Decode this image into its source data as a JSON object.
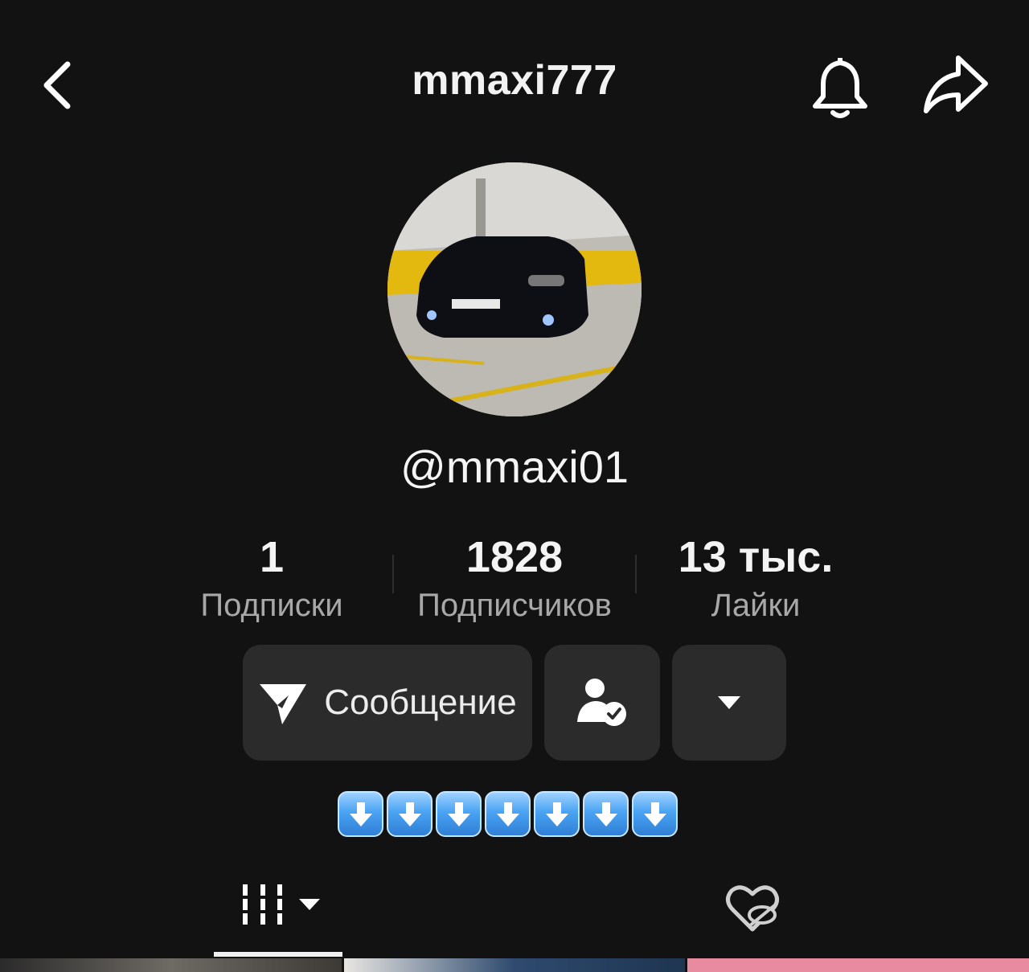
{
  "header": {
    "title": "mmaxi777",
    "back_icon": "chevron-left-icon",
    "bell_icon": "bell-icon",
    "share_icon": "share-arrow-icon"
  },
  "profile": {
    "handle": "@mmaxi01",
    "avatar_description_icon": "avatar-car-photo"
  },
  "stats": [
    {
      "value": "1",
      "label": "Подписки"
    },
    {
      "value": "1828",
      "label": "Подписчиков"
    },
    {
      "value": "13 тыс.",
      "label": "Лайки"
    }
  ],
  "actions": {
    "message_label": "Сообщение",
    "message_icon": "send-icon",
    "follow_icon": "user-check-icon",
    "more_icon": "caret-down-icon"
  },
  "bio": {
    "arrow_emoji_icon": "down-arrow-emoji",
    "arrow_count": 7
  },
  "tabs": [
    {
      "name": "videos",
      "icon": "grid-bars-icon",
      "active": true
    },
    {
      "name": "liked",
      "icon": "heart-hidden-icon",
      "active": false
    }
  ],
  "colors": {
    "background": "#121212",
    "button": "#2b2b2b",
    "muted_text": "#a8a8a8",
    "emoji_blue": "#4aa3f3"
  }
}
